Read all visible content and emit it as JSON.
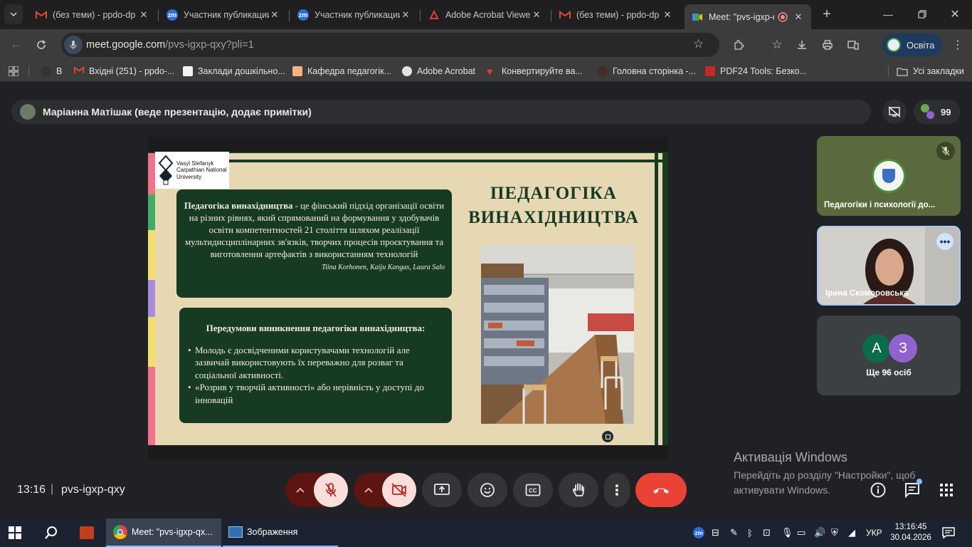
{
  "browser": {
    "tabs": [
      {
        "title": "(без теми) - ppdo-dp",
        "icon": "gmail-icon",
        "active": false
      },
      {
        "title": "Участник публикации",
        "icon": "zm-icon",
        "active": false
      },
      {
        "title": "Участник публикации",
        "icon": "zm-icon",
        "active": false
      },
      {
        "title": "Adobe Acrobat Viewer",
        "icon": "acrobat-icon",
        "active": false
      },
      {
        "title": "(без теми) - ppdo-dp",
        "icon": "gmail-icon",
        "active": false
      },
      {
        "title": "Meet: \"pvs-igxp-qxy\"",
        "icon": "meet-icon",
        "active": true
      }
    ],
    "zm_label": "zm",
    "url_host": "meet.google.com",
    "url_path": "/pvs-igxp-qxy?pli=1",
    "profile_label": "Освіта",
    "bookmarks": [
      {
        "label": "В"
      },
      {
        "label": "Вхідні (251) - ppdo-..."
      },
      {
        "label": "Заклади дошкільно..."
      },
      {
        "label": "Кафедра педагогік..."
      },
      {
        "label": "Adobe Acrobat"
      },
      {
        "label": "Конвертируйте ва..."
      },
      {
        "label": "Головна сторінка -..."
      },
      {
        "label": "PDF24 Tools: Безко..."
      }
    ],
    "all_bookmarks": "Усі закладки"
  },
  "meet": {
    "presenter_text": "Маріанна Матішак (веде презентацію, додає примітки)",
    "participants_count": "99",
    "tiles": [
      {
        "name": "Педагогіки і психології до...",
        "muted": true
      },
      {
        "name": "Ірина Скоморовська",
        "muted": false
      },
      {
        "name": "Ще 96 осіб",
        "avatars": [
          "А",
          "З"
        ]
      }
    ],
    "time": "13:16",
    "separator": "|",
    "meeting_code": "pvs-igxp-qxy"
  },
  "slide": {
    "logo_lines": [
      "Vasyl Stefanyk",
      "Carpathian National",
      "University"
    ],
    "title_line1": "ПЕДАГОГІКА",
    "title_line2": "ВИНАХІДНИЦТВА",
    "box1_bold": "Педагогіка винахідництва",
    "box1_text": " - це фінський підхід організації освіти на різних рівнях, який спрямований на формування у здобувачів освіти  компетентностей 21 століття шляхом реалізації  мультидисциплінарних зв'язків, творчих процесів проєктування та виготовлення артефактів з використанням технологій",
    "box1_source": "Tiina Korhonen, Kaiju Kangas, Laura Salo",
    "box2_heading": "Передумови виникнення педагогіки винахідництва:",
    "box2_items": [
      "Молодь є досвідченими користувачами технологій але зазвичай використовують їх  переважно для розваг та соціальної активності.",
      "«Розрив у творчій активності» або нерівність у доступі до інновацій"
    ]
  },
  "activation": {
    "title": "Активація Windows",
    "line1": "Перейдіть до розділу \"Настройки\", щоб",
    "line2": "активувати Windows."
  },
  "taskbar": {
    "chrome_task": "Meet: \"pvs-igxp-qx...",
    "photos_task": "Зображення",
    "language": "УКР",
    "time": "13:16:45",
    "date": "30.04.2026"
  },
  "colors": {
    "hangup": "#ea4335",
    "muted_bg": "#f9dedc",
    "muted_fg": "#b3261e",
    "slide_green": "#173b22",
    "slide_bg": "#e7d8b4"
  }
}
